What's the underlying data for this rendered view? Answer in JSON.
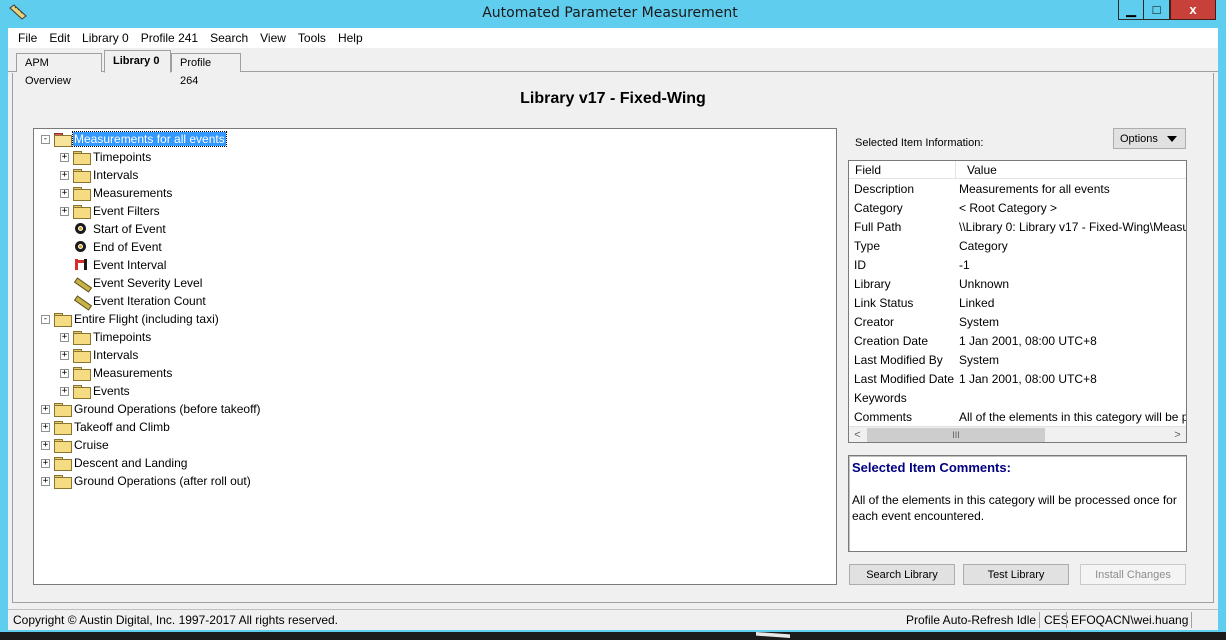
{
  "window": {
    "title": "Automated Parameter Measurement",
    "minimize_glyph": "▁",
    "maximize_glyph": "□",
    "close_glyph": "x"
  },
  "menubar": [
    "File",
    "Edit",
    "Library 0",
    "Profile 241",
    "Search",
    "View",
    "Tools",
    "Help"
  ],
  "tabs": [
    {
      "label": "APM Overview",
      "active": false
    },
    {
      "label": "Library 0",
      "active": true
    },
    {
      "label": "Profile 264",
      "active": false
    }
  ],
  "heading": "Library v17 - Fixed-Wing",
  "tree": [
    {
      "label": "Measurements for all events",
      "icon": "folder-open-icon",
      "expander": "-",
      "level": 0,
      "selected": true
    },
    {
      "label": "Timepoints",
      "icon": "folder-icon",
      "expander": "+",
      "level": 1
    },
    {
      "label": "Intervals",
      "icon": "folder-icon",
      "expander": "+",
      "level": 1
    },
    {
      "label": "Measurements",
      "icon": "folder-icon",
      "expander": "+",
      "level": 1
    },
    {
      "label": "Event Filters",
      "icon": "folder-icon",
      "expander": "+",
      "level": 1
    },
    {
      "label": "Start of Event",
      "icon": "timepoint-target-icon",
      "expander": "",
      "level": 1
    },
    {
      "label": "End of Event",
      "icon": "timepoint-target-icon",
      "expander": "",
      "level": 1
    },
    {
      "label": "Event Interval",
      "icon": "interval-icon",
      "expander": "",
      "level": 1
    },
    {
      "label": "Event Severity Level",
      "icon": "measurement-ruler-icon",
      "expander": "",
      "level": 1
    },
    {
      "label": "Event Iteration Count",
      "icon": "measurement-ruler-icon",
      "expander": "",
      "level": 1
    },
    {
      "label": "Entire Flight (including taxi)",
      "icon": "folder-icon",
      "expander": "-",
      "level": 0
    },
    {
      "label": "Timepoints",
      "icon": "folder-icon",
      "expander": "+",
      "level": 1
    },
    {
      "label": "Intervals",
      "icon": "folder-icon",
      "expander": "+",
      "level": 1
    },
    {
      "label": "Measurements",
      "icon": "folder-icon",
      "expander": "+",
      "level": 1
    },
    {
      "label": "Events",
      "icon": "folder-icon",
      "expander": "+",
      "level": 1
    },
    {
      "label": "Ground Operations (before takeoff)",
      "icon": "folder-icon",
      "expander": "+",
      "level": 0
    },
    {
      "label": "Takeoff and Climb",
      "icon": "folder-icon",
      "expander": "+",
      "level": 0
    },
    {
      "label": "Cruise",
      "icon": "folder-icon",
      "expander": "+",
      "level": 0
    },
    {
      "label": "Descent and Landing",
      "icon": "folder-icon",
      "expander": "+",
      "level": 0
    },
    {
      "label": "Ground Operations (after roll out)",
      "icon": "folder-icon",
      "expander": "+",
      "level": 0
    }
  ],
  "info": {
    "section_label": "Selected Item Information:",
    "options_label": "Options",
    "col_field": "Field",
    "col_value": "Value",
    "rows": [
      {
        "field": "Description",
        "value": "Measurements for all events"
      },
      {
        "field": "Category",
        "value": "< Root Category >"
      },
      {
        "field": "Full Path",
        "value": "\\\\Library 0: Library v17 - Fixed-Wing\\Measu"
      },
      {
        "field": "Type",
        "value": "Category"
      },
      {
        "field": "ID",
        "value": "-1"
      },
      {
        "field": "Library",
        "value": "Unknown"
      },
      {
        "field": "Link Status",
        "value": "Linked"
      },
      {
        "field": "Creator",
        "value": "System"
      },
      {
        "field": "Creation Date",
        "value": "1 Jan 2001, 08:00 UTC+8"
      },
      {
        "field": "Last Modified By",
        "value": "System"
      },
      {
        "field": "Last Modified Date",
        "value": "1 Jan 2001, 08:00 UTC+8"
      },
      {
        "field": "Keywords",
        "value": ""
      },
      {
        "field": "Comments",
        "value": "All of the elements in this category will be p"
      }
    ],
    "scroll_left": "<",
    "scroll_right": ">",
    "scroll_grip": "III"
  },
  "comments": {
    "title": "Selected Item Comments:",
    "body": "All of the elements in this category will be processed once for each event encountered."
  },
  "buttons": {
    "search": "Search Library",
    "test": "Test Library",
    "install": "Install Changes"
  },
  "status": {
    "copyright": "Copyright © Austin Digital, Inc. 1997-2017 All rights reserved.",
    "refresh": "Profile Auto-Refresh Idle",
    "ces": "CES",
    "user": "EFOQACN\\wei.huang"
  }
}
